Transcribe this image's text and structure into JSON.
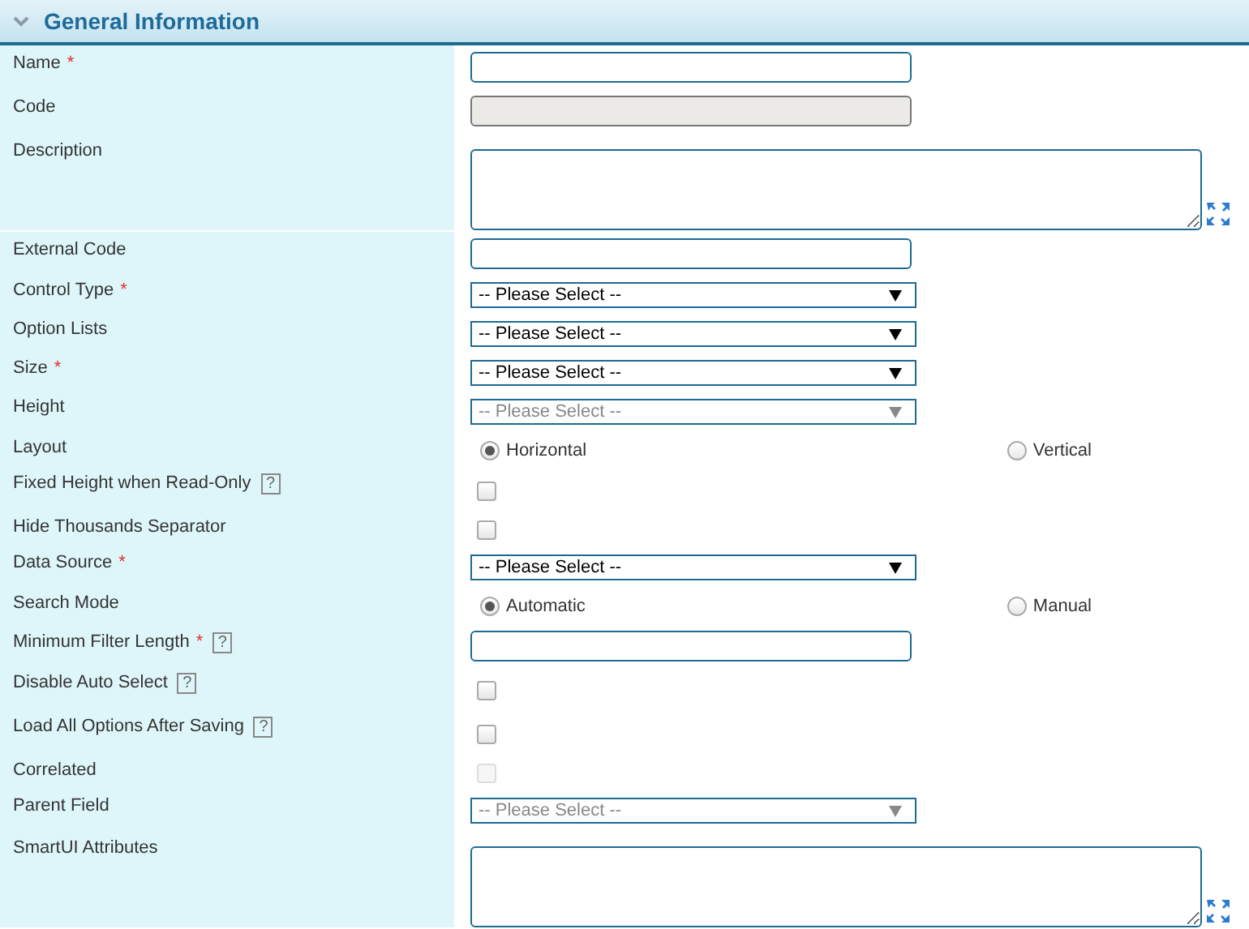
{
  "section": {
    "title": "General Information",
    "expanded": true
  },
  "rows": [
    {
      "label": "Name",
      "required": "*",
      "kind": "text",
      "disabled": false
    },
    {
      "label": "Code",
      "kind": "text",
      "disabled": true
    },
    {
      "label": "Description",
      "kind": "textarea",
      "disabled": false
    },
    {
      "label": "External Code",
      "kind": "text",
      "disabled": false
    },
    {
      "label": "Control Type",
      "required": "*",
      "kind": "select",
      "value": "-- Please Select --",
      "disabled": false
    },
    {
      "label": "Option Lists",
      "kind": "select",
      "value": "-- Please Select --",
      "disabled": false
    },
    {
      "label": "Size",
      "required": "*",
      "kind": "select",
      "value": "-- Please Select --",
      "disabled": false
    },
    {
      "label": "Height",
      "kind": "select",
      "value": "-- Please Select --",
      "disabled": true
    },
    {
      "label": "Layout",
      "kind": "radio",
      "options": [
        {
          "label": "Horizontal",
          "selected": true
        },
        {
          "label": "Vertical",
          "selected": false
        }
      ]
    },
    {
      "label": "Fixed Height when Read-Only",
      "help": "?",
      "kind": "checkbox",
      "checked": false,
      "disabled": false
    },
    {
      "label": "Hide Thousands Separator",
      "kind": "checkbox",
      "checked": false,
      "disabled": false
    },
    {
      "label": "Data Source",
      "required": "*",
      "kind": "select",
      "value": "-- Please Select --",
      "disabled": false
    },
    {
      "label": "Search Mode",
      "kind": "radio",
      "options": [
        {
          "label": "Automatic",
          "selected": true
        },
        {
          "label": "Manual",
          "selected": false
        }
      ]
    },
    {
      "label": "Minimum Filter Length",
      "required": "*",
      "help": "?",
      "kind": "text",
      "disabled": false
    },
    {
      "label": "Disable Auto Select",
      "help": "?",
      "kind": "checkbox",
      "checked": false,
      "disabled": false
    },
    {
      "label": "Load All Options After Saving",
      "help": "?",
      "kind": "checkbox",
      "checked": false,
      "disabled": false
    },
    {
      "label": "Correlated",
      "kind": "checkbox",
      "checked": false,
      "disabled": true
    },
    {
      "label": "Parent Field",
      "kind": "select",
      "value": "-- Please Select --",
      "disabled": true
    },
    {
      "label": "SmartUI Attributes",
      "kind": "textarea",
      "disabled": false
    }
  ]
}
